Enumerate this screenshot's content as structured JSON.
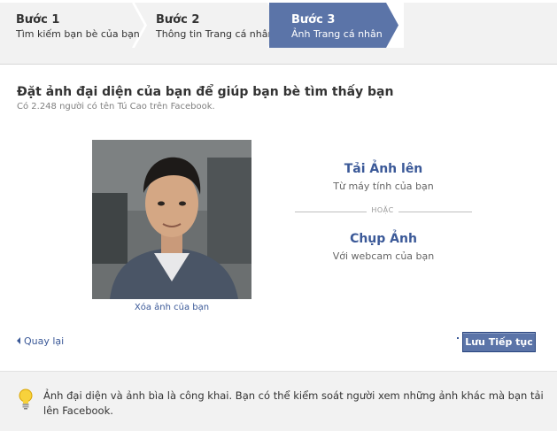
{
  "steps": [
    {
      "number": "Bước 1",
      "label": "Tìm kiếm bạn bè của bạn"
    },
    {
      "number": "Bước 2",
      "label": "Thông tin Trang cá nhân"
    },
    {
      "number": "Bước 3",
      "label": "Ảnh Trang cá nhân"
    }
  ],
  "active_step": 3,
  "main": {
    "title": "Đặt ảnh đại diện của bạn để giúp bạn bè tìm thấy bạn",
    "subtitle": "Có 2.248 người có tên Tú Cao trên Facebook.",
    "remove_photo": "Xóa ảnh của bạn",
    "upload_title": "Tải Ảnh lên",
    "upload_sub": "Từ máy tính của bạn",
    "or": "HOẶC",
    "take_title": "Chụp Ảnh",
    "take_sub": "Với webcam của bạn",
    "back": "Quay lại",
    "save": "Lưu Tiếp tục"
  },
  "info": {
    "text": "Ảnh đại diện và ảnh bìa là công khai. Bạn có thể kiểm soát người xem những ảnh khác mà bạn tải lên Facebook."
  },
  "colors": {
    "active_step": "#5b74a8",
    "link": "#3b5998",
    "inactive_step": "#f2f2f2"
  }
}
